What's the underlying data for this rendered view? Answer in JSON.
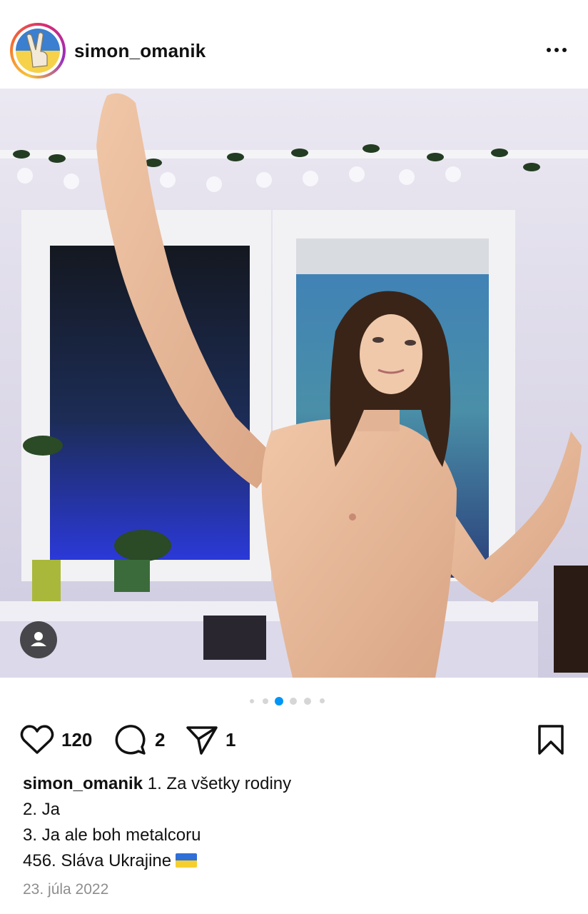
{
  "post": {
    "username": "simon_omanik",
    "avatar_icon": "peace-hand-avatar",
    "more_icon": "more-horizontal-icon",
    "photo_alt": "Shirtless young man with long hair posing in front of a window",
    "tag_people_icon": "person-tag-icon",
    "carousel": {
      "total": 5,
      "active_index": 2
    },
    "likes": "120",
    "comments": "2",
    "shares": "1",
    "icons": {
      "like": "heart-icon",
      "comment": "comment-icon",
      "share": "send-icon",
      "save": "bookmark-icon"
    },
    "caption": {
      "user": "simon_omanik",
      "line1": "1. Za všetky rodiny",
      "line2": "2. Ja",
      "line3": "3. Ja ale boh metalcoru",
      "line4": "456. Sláva Ukrajine",
      "flag_icon": "ukraine-flag-icon"
    },
    "date": "23. júla 2022",
    "colors": {
      "dot_active": "#0095f6",
      "dot_inactive": "#d6d6d6",
      "date": "#8e8e8e"
    }
  }
}
